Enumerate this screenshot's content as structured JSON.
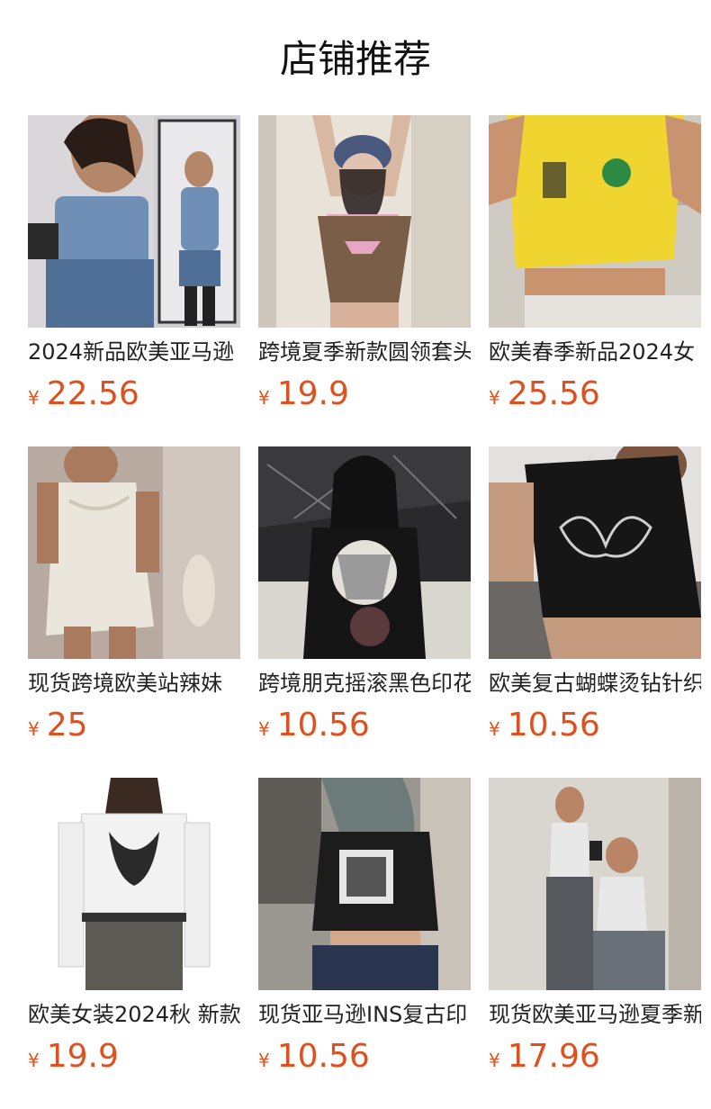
{
  "section_title": "店铺推荐",
  "products": [
    {
      "name": "2024新品欧美亚马逊",
      "currency": "¥",
      "price": "22.56",
      "image": "denim-corset-photo"
    },
    {
      "name": "跨境夏季新款圆领套头",
      "currency": "¥",
      "price": "19.9",
      "image": "brown-crop-tank-photo"
    },
    {
      "name": "欧美春季新品2024女",
      "currency": "¥",
      "price": "25.56",
      "image": "yellow-jersey-tee-photo"
    },
    {
      "name": "现货跨境欧美站辣妹",
      "currency": "¥",
      "price": "25",
      "image": "white-satin-dress-photo"
    },
    {
      "name": "跨境朋克摇滚黑色印花",
      "currency": "¥",
      "price": "10.56",
      "image": "black-graphic-tee-photo"
    },
    {
      "name": "欧美复古蝴蝶烫钻针织",
      "currency": "¥",
      "price": "10.56",
      "image": "black-rhinestone-butterfly-top-photo"
    },
    {
      "name": "欧美女装2024秋 新款",
      "currency": "¥",
      "price": "19.9",
      "image": "white-longsleeve-print-photo"
    },
    {
      "name": "现货亚马逊INS复古印",
      "currency": "¥",
      "price": "10.56",
      "image": "black-crop-longsleeve-photo"
    },
    {
      "name": "现货欧美亚马逊夏季新",
      "currency": "¥",
      "price": "17.96",
      "image": "white-halter-top-photo"
    }
  ]
}
